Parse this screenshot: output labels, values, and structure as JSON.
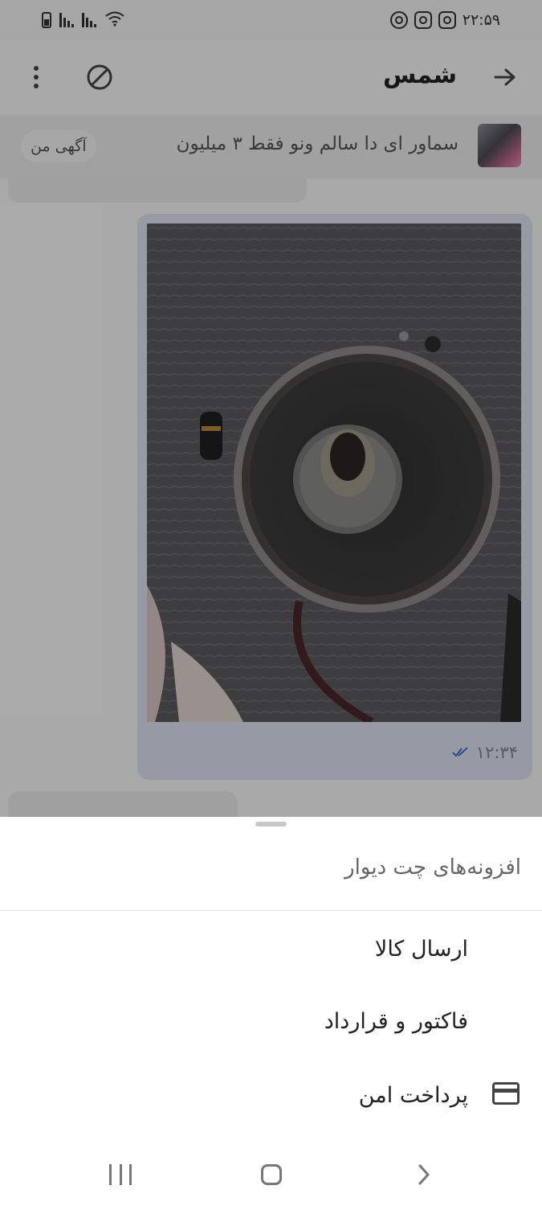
{
  "status_bar": {
    "time": "۲۲:۵۹",
    "icons": [
      "instagram-icon",
      "instagram-icon",
      "whatsapp-icon",
      "wifi-icon",
      "signal-icon",
      "signal-icon",
      "battery-icon"
    ]
  },
  "header": {
    "title": "شمس",
    "icons": [
      "back-arrow-icon",
      "block-icon",
      "more-vertical-icon"
    ]
  },
  "ad": {
    "title": "سماور ای دا سالم ونو فقط ۳ میلیون",
    "badge_label": "آگهی من"
  },
  "messages": [
    {
      "type": "image",
      "time": "۱۲:۳۴",
      "status_icon": "double-check-icon"
    }
  ],
  "sheet": {
    "title": "افزونه‌های چت دیوار",
    "options": [
      {
        "label": "ارسال کالا",
        "icon": ""
      },
      {
        "label": "فاکتور و قرارداد",
        "icon": ""
      },
      {
        "label": "پرداخت امن",
        "icon": "credit-card-icon"
      }
    ]
  },
  "nav_bar": {
    "icons": [
      "recent-apps-icon",
      "home-icon",
      "back-icon"
    ]
  },
  "colors": {
    "accent_check": "#3b6fd4",
    "image_bubble": "#dde3f2",
    "overlay": "rgba(0,0,0,0.32)"
  }
}
